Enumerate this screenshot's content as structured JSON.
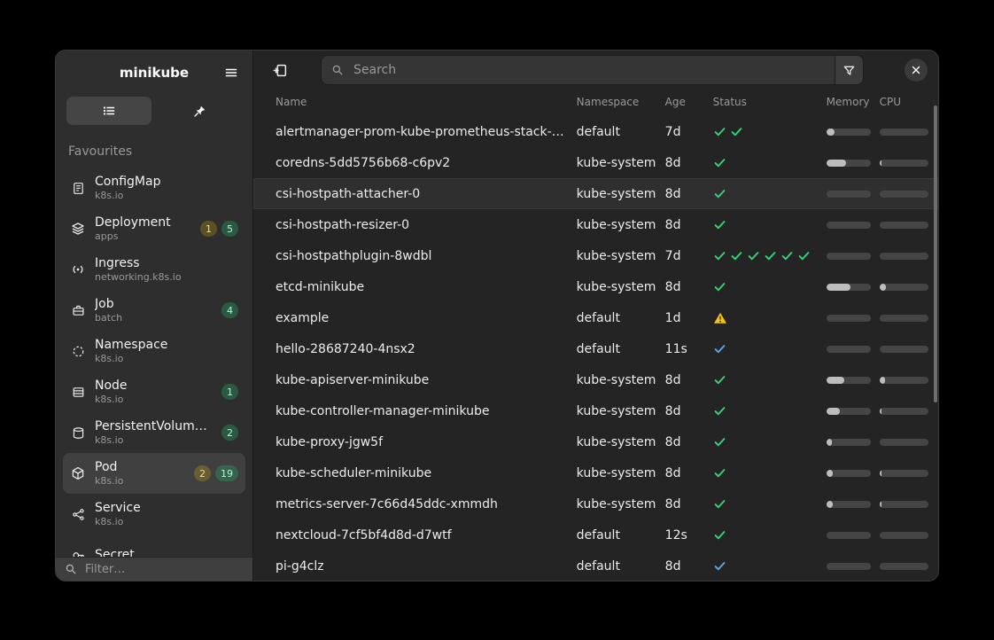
{
  "window": {
    "title": "minikube"
  },
  "colors": {
    "success_green": "#34d178",
    "info_blue": "#62a0ea",
    "warning_yellow": "#f5c211",
    "bar_fill": "#bdbdbd",
    "badge_green": "#26a269",
    "badge_yellow": "#cdab0a"
  },
  "sidebar": {
    "title": "minikube",
    "menu_icon": "menu-icon",
    "view_icons": [
      "list-view-icon",
      "pin-icon"
    ],
    "section_label": "Favourites",
    "filter_placeholder": "Filter…",
    "filter_icon": "search-icon",
    "items": [
      {
        "label": "ConfigMap",
        "sub": "k8s.io",
        "icon": "configmap-icon",
        "badges": [],
        "selected": false
      },
      {
        "label": "Deployment",
        "sub": "apps",
        "icon": "deployment-icon",
        "badges": [
          {
            "text": "1",
            "color": "yellow"
          },
          {
            "text": "5",
            "color": "green"
          }
        ],
        "selected": false
      },
      {
        "label": "Ingress",
        "sub": "networking.k8s.io",
        "icon": "ingress-icon",
        "badges": [],
        "selected": false
      },
      {
        "label": "Job",
        "sub": "batch",
        "icon": "job-icon",
        "badges": [
          {
            "text": "4",
            "color": "green"
          }
        ],
        "selected": false
      },
      {
        "label": "Namespace",
        "sub": "k8s.io",
        "icon": "namespace-icon",
        "badges": [],
        "selected": false
      },
      {
        "label": "Node",
        "sub": "k8s.io",
        "icon": "node-icon",
        "badges": [
          {
            "text": "1",
            "color": "green"
          }
        ],
        "selected": false
      },
      {
        "label": "PersistentVolumeCl…",
        "sub": "k8s.io",
        "icon": "persistentvolumeclaim-icon",
        "badges": [
          {
            "text": "2",
            "color": "green"
          }
        ],
        "selected": false
      },
      {
        "label": "Pod",
        "sub": "k8s.io",
        "icon": "pod-icon",
        "badges": [
          {
            "text": "2",
            "color": "yellow"
          },
          {
            "text": "19",
            "color": "green"
          }
        ],
        "selected": true
      },
      {
        "label": "Service",
        "sub": "k8s.io",
        "icon": "service-icon",
        "badges": [],
        "selected": false
      },
      {
        "label": "Secret",
        "sub": "",
        "icon": "secret-icon",
        "badges": [],
        "selected": false
      }
    ]
  },
  "header": {
    "new_window_icon": "new-window-icon",
    "search_placeholder": "Search",
    "search_icon": "search-icon",
    "filter_icon": "filter-icon",
    "close_icon": "close-icon"
  },
  "table": {
    "columns": [
      "Name",
      "Namespace",
      "Age",
      "Status",
      "Memory",
      "CPU"
    ],
    "rows": [
      {
        "name": "alertmanager-prom-kube-prometheus-stack-…",
        "namespace": "default",
        "age": "7d",
        "status": {
          "green": 2,
          "blue": 0,
          "warning": false
        },
        "memory": 0.18,
        "cpu": 0,
        "highlight": false
      },
      {
        "name": "coredns-5dd5756b68-c6pv2",
        "namespace": "kube-system",
        "age": "8d",
        "status": {
          "green": 1,
          "blue": 0,
          "warning": false
        },
        "memory": 0.45,
        "cpu": 0.05,
        "highlight": false
      },
      {
        "name": "csi-hostpath-attacher-0",
        "namespace": "kube-system",
        "age": "8d",
        "status": {
          "green": 1,
          "blue": 0,
          "warning": false
        },
        "memory": 0,
        "cpu": 0,
        "highlight": true
      },
      {
        "name": "csi-hostpath-resizer-0",
        "namespace": "kube-system",
        "age": "8d",
        "status": {
          "green": 1,
          "blue": 0,
          "warning": false
        },
        "memory": 0,
        "cpu": 0,
        "highlight": false
      },
      {
        "name": "csi-hostpathplugin-8wdbl",
        "namespace": "kube-system",
        "age": "7d",
        "status": {
          "green": 6,
          "blue": 0,
          "warning": false
        },
        "memory": 0,
        "cpu": 0,
        "highlight": false
      },
      {
        "name": "etcd-minikube",
        "namespace": "kube-system",
        "age": "8d",
        "status": {
          "green": 1,
          "blue": 0,
          "warning": false
        },
        "memory": 0.55,
        "cpu": 0.14,
        "highlight": false
      },
      {
        "name": "example",
        "namespace": "default",
        "age": "1d",
        "status": {
          "green": 0,
          "blue": 0,
          "warning": true
        },
        "memory": 0,
        "cpu": 0,
        "highlight": false
      },
      {
        "name": "hello-28687240-4nsx2",
        "namespace": "default",
        "age": "11s",
        "status": {
          "green": 0,
          "blue": 1,
          "warning": false
        },
        "memory": 0,
        "cpu": 0,
        "highlight": false
      },
      {
        "name": "kube-apiserver-minikube",
        "namespace": "kube-system",
        "age": "8d",
        "status": {
          "green": 1,
          "blue": 0,
          "warning": false
        },
        "memory": 0.4,
        "cpu": 0.12,
        "highlight": false
      },
      {
        "name": "kube-controller-manager-minikube",
        "namespace": "kube-system",
        "age": "8d",
        "status": {
          "green": 1,
          "blue": 0,
          "warning": false
        },
        "memory": 0.3,
        "cpu": 0.04,
        "highlight": false
      },
      {
        "name": "kube-proxy-jgw5f",
        "namespace": "kube-system",
        "age": "8d",
        "status": {
          "green": 1,
          "blue": 0,
          "warning": false
        },
        "memory": 0.12,
        "cpu": 0,
        "highlight": false
      },
      {
        "name": "kube-scheduler-minikube",
        "namespace": "kube-system",
        "age": "8d",
        "status": {
          "green": 1,
          "blue": 0,
          "warning": false
        },
        "memory": 0.15,
        "cpu": 0.04,
        "highlight": false
      },
      {
        "name": "metrics-server-7c66d45ddc-xmmdh",
        "namespace": "kube-system",
        "age": "8d",
        "status": {
          "green": 1,
          "blue": 0,
          "warning": false
        },
        "memory": 0.14,
        "cpu": 0.05,
        "highlight": false
      },
      {
        "name": "nextcloud-7cf5bf4d8d-d7wtf",
        "namespace": "default",
        "age": "12s",
        "status": {
          "green": 1,
          "blue": 0,
          "warning": false
        },
        "memory": 0,
        "cpu": 0,
        "highlight": false
      },
      {
        "name": "pi-g4clz",
        "namespace": "default",
        "age": "8d",
        "status": {
          "green": 0,
          "blue": 1,
          "warning": false
        },
        "memory": 0,
        "cpu": 0,
        "highlight": false
      }
    ]
  }
}
